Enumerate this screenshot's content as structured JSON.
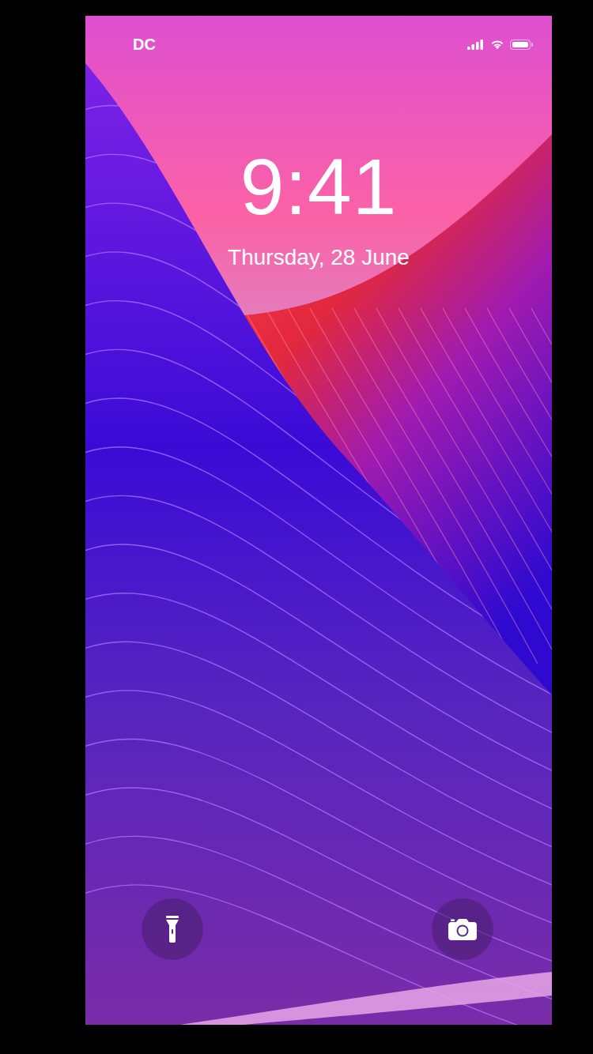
{
  "status_bar": {
    "carrier": "DC",
    "signal": {
      "level": 1
    },
    "wifi": {
      "level": 1
    },
    "battery": {
      "level": 1
    }
  },
  "lock_screen": {
    "time": "9:41",
    "date": "Thursday, 28 June"
  }
}
